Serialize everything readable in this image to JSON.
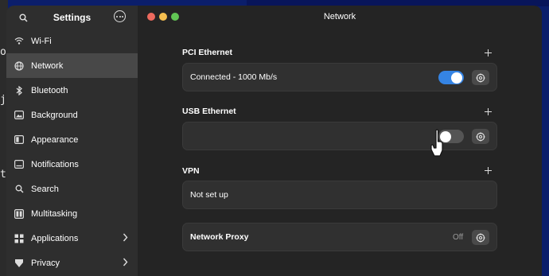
{
  "background": {
    "terminal_chars": [
      "o",
      "j",
      "t"
    ]
  },
  "sidebar": {
    "title": "Settings",
    "items": [
      {
        "label": "Wi-Fi",
        "icon": "wifi-icon"
      },
      {
        "label": "Network",
        "icon": "network-icon",
        "active": true
      },
      {
        "label": "Bluetooth",
        "icon": "bluetooth-icon"
      },
      {
        "label": "Background",
        "icon": "background-icon"
      },
      {
        "label": "Appearance",
        "icon": "appearance-icon"
      },
      {
        "label": "Notifications",
        "icon": "notifications-icon"
      },
      {
        "label": "Search",
        "icon": "search-icon"
      },
      {
        "label": "Multitasking",
        "icon": "multitasking-icon"
      },
      {
        "label": "Applications",
        "icon": "applications-icon",
        "chevron": true
      },
      {
        "label": "Privacy",
        "icon": "privacy-icon",
        "chevron": true
      }
    ]
  },
  "window": {
    "title": "Network"
  },
  "sections": {
    "pci": {
      "label": "PCI Ethernet",
      "status": "Connected - 1000 Mb/s",
      "toggle_on": true
    },
    "usb": {
      "label": "USB Ethernet",
      "status": "",
      "toggle_on": false
    },
    "vpn": {
      "label": "VPN",
      "status": "Not set up"
    },
    "proxy": {
      "label": "Network Proxy",
      "status": "Off"
    }
  },
  "colors": {
    "accent": "#3584e4",
    "sidebar_bg": "#2e2e2e",
    "main_bg": "#242424",
    "card_bg": "#303030",
    "desktop_bg": "#0b1e6b"
  }
}
